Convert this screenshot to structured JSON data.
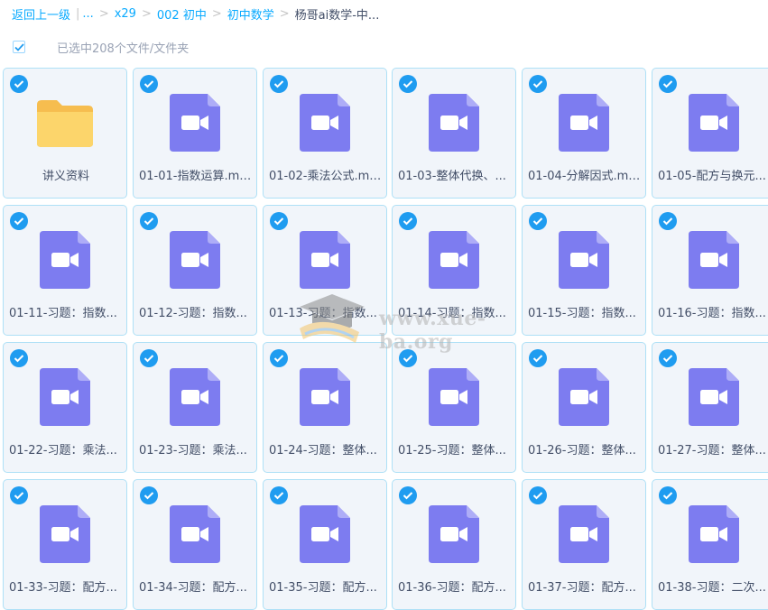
{
  "breadcrumb": {
    "back": "返回上一级",
    "ellipsis": "...",
    "items": [
      "x29",
      "002 初中",
      "初中数学"
    ],
    "current": "杨哥ai数学-中..."
  },
  "selection": {
    "text": "已选中208个文件/文件夹",
    "checked": true
  },
  "files": [
    {
      "name": "讲义资料",
      "type": "folder"
    },
    {
      "name": "01-01-指数运算.mp4",
      "type": "video"
    },
    {
      "name": "01-02-乘法公式.mp4",
      "type": "video"
    },
    {
      "name": "01-03-整体代换、...",
      "type": "video"
    },
    {
      "name": "01-04-分解因式.mp4",
      "type": "video"
    },
    {
      "name": "01-05-配方与换元...",
      "type": "video"
    },
    {
      "name": "01-11-习题：指数...",
      "type": "video"
    },
    {
      "name": "01-12-习题：指数...",
      "type": "video"
    },
    {
      "name": "01-13-习题：指数...",
      "type": "video"
    },
    {
      "name": "01-14-习题：指数...",
      "type": "video"
    },
    {
      "name": "01-15-习题：指数...",
      "type": "video"
    },
    {
      "name": "01-16-习题：指数...",
      "type": "video"
    },
    {
      "name": "01-22-习题：乘法...",
      "type": "video"
    },
    {
      "name": "01-23-习题：乘法...",
      "type": "video"
    },
    {
      "name": "01-24-习题：整体...",
      "type": "video"
    },
    {
      "name": "01-25-习题：整体...",
      "type": "video"
    },
    {
      "name": "01-26-习题：整体...",
      "type": "video"
    },
    {
      "name": "01-27-习题：整体...",
      "type": "video"
    },
    {
      "name": "01-33-习题：配方...",
      "type": "video"
    },
    {
      "name": "01-34-习题：配方...",
      "type": "video"
    },
    {
      "name": "01-35-习题：配方...",
      "type": "video"
    },
    {
      "name": "01-36-习题：配方...",
      "type": "video"
    },
    {
      "name": "01-37-习题：配方...",
      "type": "video"
    },
    {
      "name": "01-38-习题：二次...",
      "type": "video"
    }
  ],
  "watermark": "www.xue-ba.org",
  "colors": {
    "link": "#09aaff",
    "check": "#1f9cf0",
    "video_icon": "#7d7cf0",
    "folder_icon": "#fcd56b",
    "tile_border": "#aee0f6"
  }
}
